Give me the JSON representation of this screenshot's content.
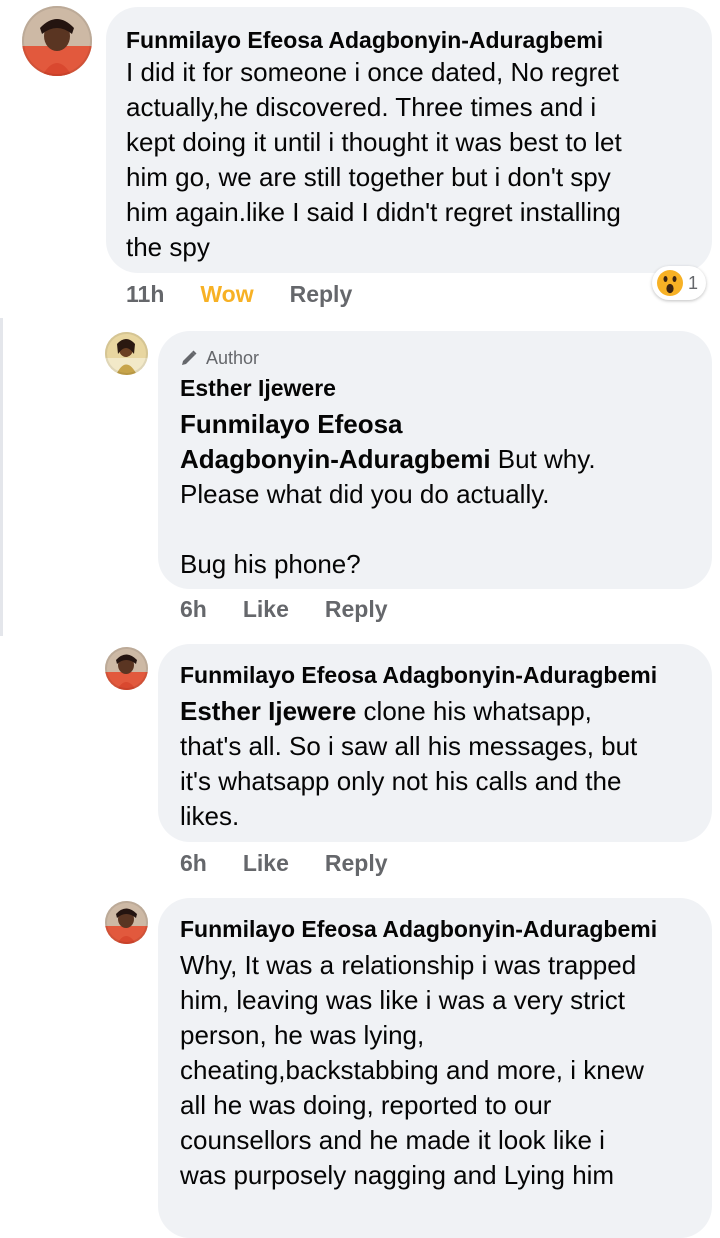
{
  "comments": [
    {
      "author": "Funmilayo Efeosa Adagbonyin-Aduragbemi",
      "mention": "",
      "text": "I did it for someone i once dated, No regret\nactually,he discovered. Three times and i\nkept doing it until i thought it was best to let\nhim go, we are still together but i don't spy\nhim again.like I said I didn't regret installing\nthe spy",
      "time": "11h",
      "reaction_label": "Wow",
      "reply_label": "Reply",
      "reaction_count": "1",
      "reaction_icon": "wow-emoji-icon"
    },
    {
      "badge": "Author",
      "author": "Esther Ijewere",
      "mention": "Funmilayo Efeosa\nAdagbonyin-Aduragbemi",
      "text": " But why.\nPlease what did you do actually.\n\nBug his phone?",
      "time": "6h",
      "like_label": "Like",
      "reply_label": "Reply"
    },
    {
      "author": "Funmilayo Efeosa Adagbonyin-Aduragbemi",
      "mention": "Esther Ijewere",
      "text": " clone his whatsapp,\nthat's all. So i saw all his messages, but\nit's whatsapp only not his calls and the\nlikes.",
      "time": "6h",
      "like_label": "Like",
      "reply_label": "Reply"
    },
    {
      "author": "Funmilayo Efeosa Adagbonyin-Aduragbemi",
      "mention": "",
      "text": "Why, It was a relationship i was trapped\nhim, leaving was like i was a very strict\nperson, he was lying,\ncheating,backstabbing and more, i knew\nall he was doing, reported to our\ncounsellors and he made it look like i\nwas purposely nagging and Lying him"
    }
  ],
  "colors": {
    "bubble": "#f0f2f5",
    "meta_text": "#65676b",
    "wow": "#f7b125"
  }
}
